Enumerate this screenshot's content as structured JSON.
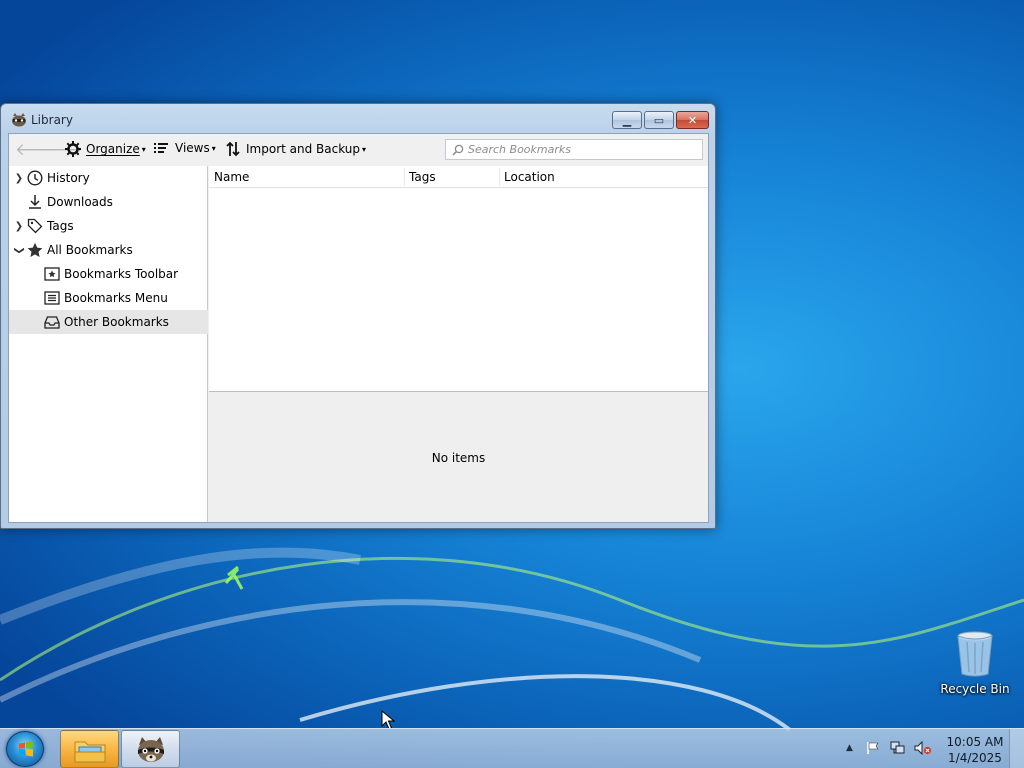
{
  "window": {
    "title": "Library",
    "caption_buttons": {
      "minimize": "minimize",
      "maximize": "maximize",
      "close": "close"
    }
  },
  "toolbar": {
    "organize_label": "Organize",
    "views_label": "Views",
    "import_backup_label": "Import and Backup",
    "search_placeholder": "Search Bookmarks"
  },
  "sidebar": {
    "items": [
      {
        "label": "History",
        "icon": "clock-icon",
        "twisty": "collapsed"
      },
      {
        "label": "Downloads",
        "icon": "download-icon",
        "twisty": "none"
      },
      {
        "label": "Tags",
        "icon": "tag-icon",
        "twisty": "collapsed"
      },
      {
        "label": "All Bookmarks",
        "icon": "star-icon",
        "twisty": "expanded"
      },
      {
        "label": "Bookmarks Toolbar",
        "icon": "bookmarks-toolbar-icon",
        "twisty": "none"
      },
      {
        "label": "Bookmarks Menu",
        "icon": "bookmarks-menu-icon",
        "twisty": "none"
      },
      {
        "label": "Other Bookmarks",
        "icon": "inbox-icon",
        "twisty": "none",
        "selected": true
      }
    ]
  },
  "list": {
    "columns": [
      "Name",
      "Tags",
      "Location"
    ]
  },
  "details": {
    "empty_text": "No items"
  },
  "desktop": {
    "recycle_bin_label": "Recycle Bin"
  },
  "taskbar": {
    "clock_time": "10:05 AM",
    "clock_date": "1/4/2025"
  },
  "colors": {
    "desktop_blue": "#1683d6",
    "window_frame": "#b9d1ea",
    "close_button": "#c34a34",
    "selected_row": "#e6e6e6"
  }
}
